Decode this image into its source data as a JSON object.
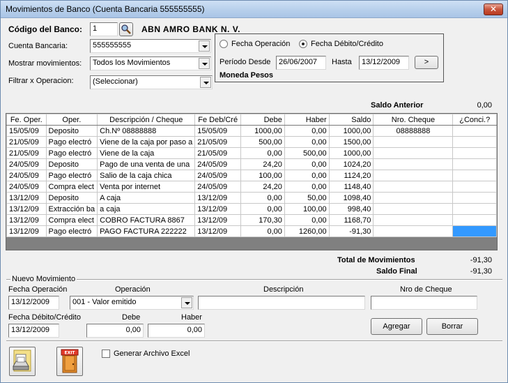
{
  "window": {
    "title": "Movimientos de Banco (Cuenta Bancaria 555555555)",
    "close_label": "✕"
  },
  "header": {
    "codigo_label": "Código del Banco:",
    "codigo_value": "1",
    "bank_name": "ABN AMRO BANK N. V.",
    "cuenta_label": "Cuenta Bancaria:",
    "cuenta_value": "555555555",
    "mostrar_label": "Mostrar movimientos:",
    "mostrar_value": "Todos los Movimientos",
    "filtrar_label": "Filtrar x Operacion:",
    "filtrar_value": "(Seleccionar)"
  },
  "date_filter": {
    "radio_fecha_operacion": "Fecha Operación",
    "radio_fecha_debito": "Fecha Débito/Crédito",
    "selected": "fecha_debito",
    "periodo_label": "Período Desde",
    "desde_value": "26/06/2007",
    "hasta_label": "Hasta",
    "hasta_value": "13/12/2009",
    "go_label": ">",
    "moneda": "Moneda Pesos"
  },
  "saldo_anterior": {
    "label": "Saldo Anterior",
    "value": "0,00"
  },
  "table": {
    "columns": [
      "Fe. Oper.",
      "Oper.",
      "Descripción / Cheque",
      "Fe Deb/Cré",
      "Debe",
      "Haber",
      "Saldo",
      "Nro. Cheque",
      "¿Conci.?"
    ],
    "rows": [
      [
        "15/05/09",
        "Deposito",
        "Ch.Nº 08888888",
        "15/05/09",
        "1000,00",
        "0,00",
        "1000,00",
        "08888888",
        ""
      ],
      [
        "21/05/09",
        "Pago electró",
        "Viene de la caja por paso a",
        "21/05/09",
        "500,00",
        "0,00",
        "1500,00",
        "",
        ""
      ],
      [
        "21/05/09",
        "Pago electró",
        "Viene de la caja",
        "21/05/09",
        "0,00",
        "500,00",
        "1000,00",
        "",
        ""
      ],
      [
        "24/05/09",
        "Deposito",
        "Pago de una venta de una",
        "24/05/09",
        "24,20",
        "0,00",
        "1024,20",
        "",
        ""
      ],
      [
        "24/05/09",
        "Pago electró",
        "Salio de la caja chica",
        "24/05/09",
        "100,00",
        "0,00",
        "1124,20",
        "",
        ""
      ],
      [
        "24/05/09",
        "Compra elect",
        "Venta por internet",
        "24/05/09",
        "24,20",
        "0,00",
        "1148,40",
        "",
        ""
      ],
      [
        "13/12/09",
        "Deposito",
        "A caja",
        "13/12/09",
        "0,00",
        "50,00",
        "1098,40",
        "",
        ""
      ],
      [
        "13/12/09",
        "Extracción ba",
        "a caja",
        "13/12/09",
        "0,00",
        "100,00",
        "998,40",
        "",
        ""
      ],
      [
        "13/12/09",
        "Compra elect",
        "COBRO FACTURA 8867",
        "13/12/09",
        "170,30",
        "0,00",
        "1168,70",
        "",
        ""
      ],
      [
        "13/12/09",
        "Pago electró",
        "PAGO FACTURA 222222",
        "13/12/09",
        "0,00",
        "1260,00",
        "-91,30",
        "",
        ""
      ]
    ]
  },
  "totals": {
    "total_label": "Total de Movimientos",
    "total_value": "-91,30",
    "final_label": "Saldo Final",
    "final_value": "-91,30"
  },
  "nuevo": {
    "group_label": "Nuevo Movimiento",
    "fecha_op_label": "Fecha Operación",
    "fecha_op_value": "13/12/2009",
    "operacion_label": "Operación",
    "operacion_value": "001 - Valor emitido",
    "descripcion_label": "Descripción",
    "descripcion_value": "",
    "cheque_label": "Nro de Cheque",
    "cheque_value": "",
    "fecha_deb_label": "Fecha Débito/Crédito",
    "fecha_deb_value": "13/12/2009",
    "debe_label": "Debe",
    "debe_value": "0,00",
    "haber_label": "Haber",
    "haber_value": "0,00",
    "agregar_label": "Agregar",
    "borrar_label": "Borrar"
  },
  "footer": {
    "excel_label": "Generar Archivo Excel",
    "exit_label": "EXIT"
  }
}
